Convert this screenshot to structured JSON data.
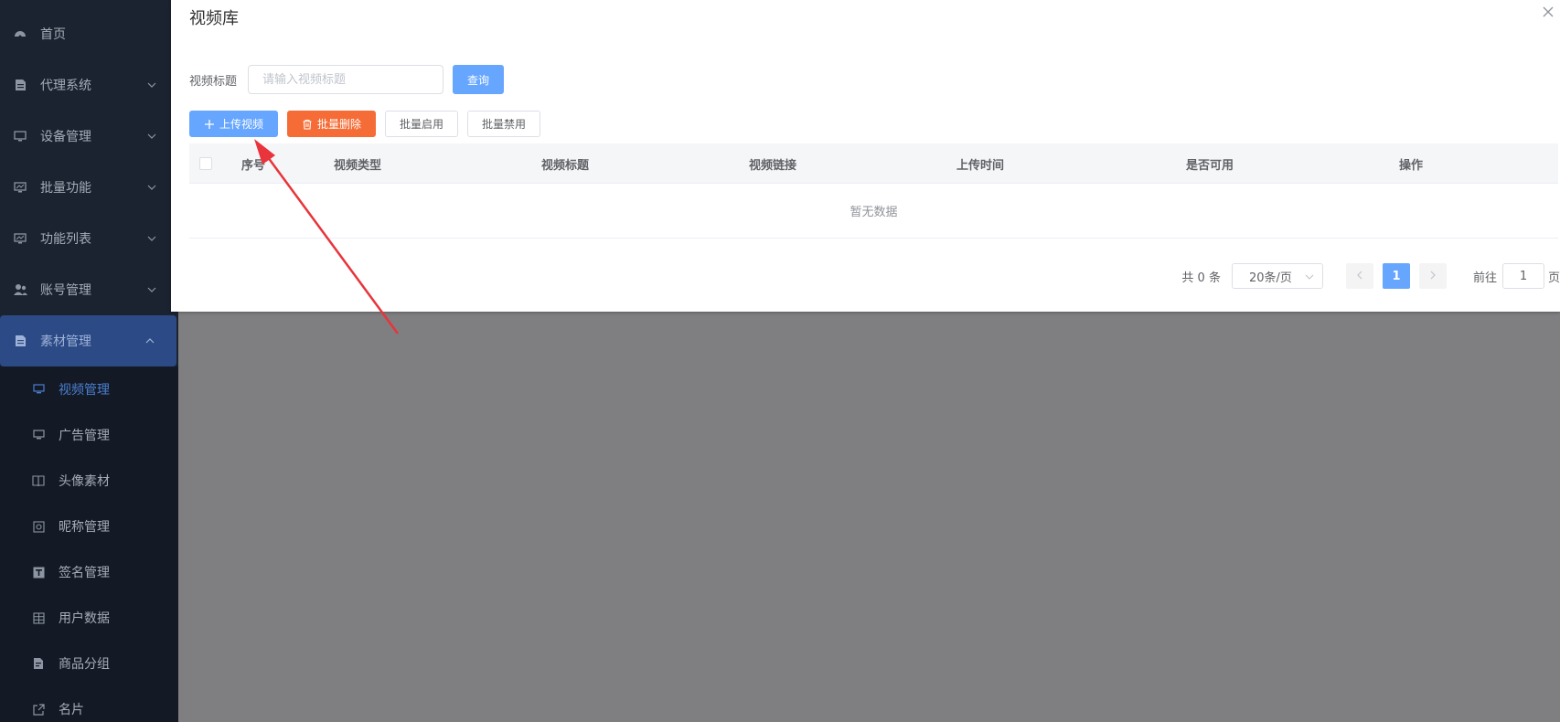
{
  "sidebar": {
    "items": [
      {
        "label": "首页"
      },
      {
        "label": "代理系统"
      },
      {
        "label": "设备管理"
      },
      {
        "label": "批量功能"
      },
      {
        "label": "功能列表"
      },
      {
        "label": "账号管理"
      },
      {
        "label": "素材管理"
      }
    ],
    "subitems": [
      {
        "label": "视频管理"
      },
      {
        "label": "广告管理"
      },
      {
        "label": "头像素材"
      },
      {
        "label": "昵称管理"
      },
      {
        "label": "签名管理"
      },
      {
        "label": "用户数据"
      },
      {
        "label": "商品分组"
      },
      {
        "label": "名片"
      }
    ]
  },
  "dialog": {
    "title": "视频库",
    "search": {
      "label": "视频标题",
      "placeholder": "请输入视频标题",
      "query_label": "查询"
    },
    "actions": {
      "upload_label": "上传视频",
      "batch_delete_label": "批量删除",
      "batch_enable_label": "批量启用",
      "batch_disable_label": "批量禁用"
    },
    "table": {
      "columns": [
        "序号",
        "视频类型",
        "视频标题",
        "视频链接",
        "上传时间",
        "是否可用",
        "操作"
      ],
      "empty_text": "暂无数据"
    },
    "pagination": {
      "total": "共 0 条",
      "page_size": "20条/页",
      "current_page": "1",
      "goto_prefix": "前往",
      "goto_value": "1",
      "goto_suffix": "页"
    }
  },
  "colors": {
    "primary": "#66a6ff",
    "danger": "#f56c37",
    "sidebar_bg": "#1b2230",
    "active_menu": "#2c4a85",
    "annotation_arrow": "#e8343a"
  }
}
